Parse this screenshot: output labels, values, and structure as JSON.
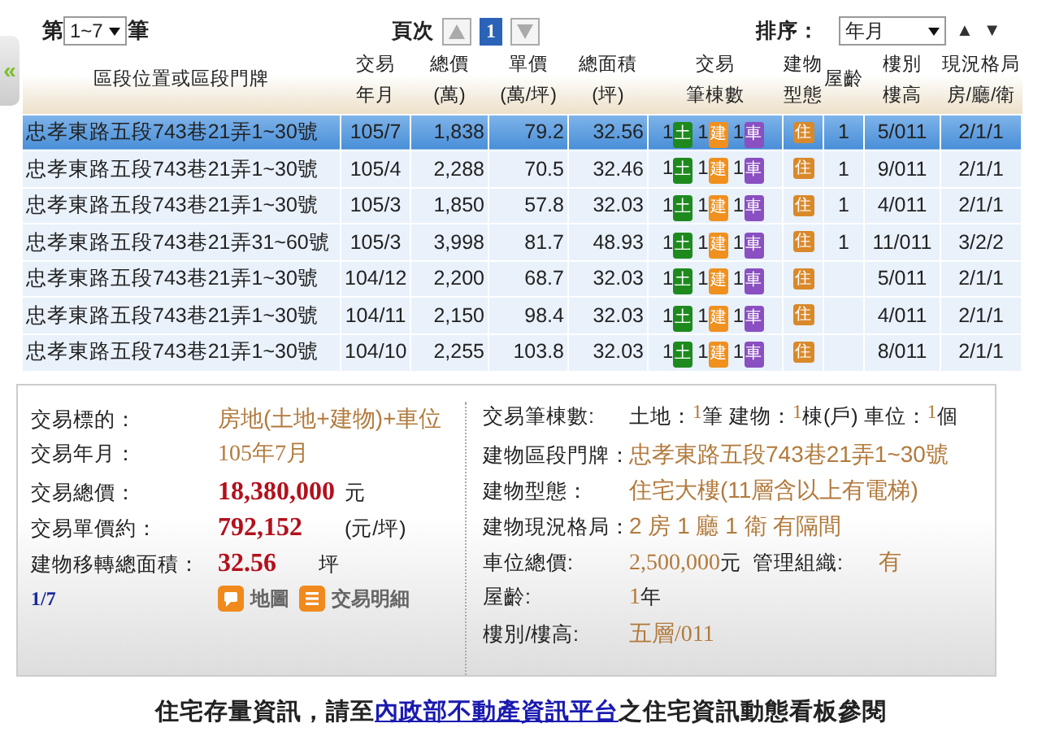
{
  "pager": {
    "prefix": "第",
    "range": "1~7",
    "suffix": "筆",
    "page_label": "頁次",
    "pages": [
      {
        "label": "1",
        "selected": true
      }
    ],
    "sort_label": "排序：",
    "sort_value": "年月",
    "sort_asc": "▲",
    "sort_desc": "▼"
  },
  "sidebar_toggle": "«",
  "table": {
    "columns": [
      [
        "區段位置或區段門牌"
      ],
      [
        "交易",
        "年月"
      ],
      [
        "總價",
        "(萬)"
      ],
      [
        "單價",
        "(萬/坪)"
      ],
      [
        "總面積",
        "(坪)"
      ],
      [
        "交易",
        "筆棟數"
      ],
      [
        "建物",
        "型態"
      ],
      [
        "屋齡"
      ],
      [
        "樓別",
        "樓高"
      ],
      [
        "現況格局",
        "房/廳/衛"
      ]
    ],
    "rows": [
      {
        "address": "忠孝東路五段743巷21弄1~30號",
        "date": "105/7",
        "total": "1,838",
        "unit": "79.2",
        "area": "32.56",
        "counts": [
          {
            "count": "1",
            "label": "土",
            "color": "#1e8a1e"
          },
          {
            "count": "1",
            "label": "建",
            "color": "#f0901e"
          },
          {
            "count": "1",
            "label": "車",
            "color": "#8a4fc0"
          }
        ],
        "type": "住",
        "age": "1",
        "floor": "5/011",
        "layout": "2/1/1",
        "selected": true
      },
      {
        "address": "忠孝東路五段743巷21弄1~30號",
        "date": "105/4",
        "total": "2,288",
        "unit": "70.5",
        "area": "32.46",
        "counts": [
          {
            "count": "1",
            "label": "土",
            "color": "#1e8a1e"
          },
          {
            "count": "1",
            "label": "建",
            "color": "#f0901e"
          },
          {
            "count": "1",
            "label": "車",
            "color": "#8a4fc0"
          }
        ],
        "type": "住",
        "age": "1",
        "floor": "9/011",
        "layout": "2/1/1",
        "selected": false
      },
      {
        "address": "忠孝東路五段743巷21弄1~30號",
        "date": "105/3",
        "total": "1,850",
        "unit": "57.8",
        "area": "32.03",
        "counts": [
          {
            "count": "1",
            "label": "土",
            "color": "#1e8a1e"
          },
          {
            "count": "1",
            "label": "建",
            "color": "#f0901e"
          },
          {
            "count": "1",
            "label": "車",
            "color": "#8a4fc0"
          }
        ],
        "type": "住",
        "age": "1",
        "floor": "4/011",
        "layout": "2/1/1",
        "selected": false
      },
      {
        "address": "忠孝東路五段743巷21弄31~60號",
        "date": "105/3",
        "total": "3,998",
        "unit": "81.7",
        "area": "48.93",
        "counts": [
          {
            "count": "1",
            "label": "土",
            "color": "#1e8a1e"
          },
          {
            "count": "1",
            "label": "建",
            "color": "#f0901e"
          },
          {
            "count": "1",
            "label": "車",
            "color": "#8a4fc0"
          }
        ],
        "type": "住",
        "age": "1",
        "floor": "11/011",
        "layout": "3/2/2",
        "selected": false
      },
      {
        "address": "忠孝東路五段743巷21弄1~30號",
        "date": "104/12",
        "total": "2,200",
        "unit": "68.7",
        "area": "32.03",
        "counts": [
          {
            "count": "1",
            "label": "土",
            "color": "#1e8a1e"
          },
          {
            "count": "1",
            "label": "建",
            "color": "#f0901e"
          },
          {
            "count": "1",
            "label": "車",
            "color": "#8a4fc0"
          }
        ],
        "type": "住",
        "floor": "5/011",
        "layout": "2/1/1",
        "selected": false
      },
      {
        "address": "忠孝東路五段743巷21弄1~30號",
        "date": "104/11",
        "total": "2,150",
        "unit": "98.4",
        "area": "32.03",
        "counts": [
          {
            "count": "1",
            "label": "土",
            "color": "#1e8a1e"
          },
          {
            "count": "1",
            "label": "建",
            "color": "#f0901e"
          },
          {
            "count": "1",
            "label": "車",
            "color": "#8a4fc0"
          }
        ],
        "type": "住",
        "floor": "4/011",
        "layout": "2/1/1",
        "selected": false
      },
      {
        "address": "忠孝東路五段743巷21弄1~30號",
        "date": "104/10",
        "total": "2,255",
        "unit": "103.8",
        "area": "32.03",
        "counts": [
          {
            "count": "1",
            "label": "土",
            "color": "#1e8a1e"
          },
          {
            "count": "1",
            "label": "建",
            "color": "#f0901e"
          },
          {
            "count": "1",
            "label": "車",
            "color": "#8a4fc0"
          }
        ],
        "type": "住",
        "floor": "8/011",
        "layout": "2/1/1",
        "selected": false
      }
    ]
  },
  "detail": {
    "left": [
      {
        "label": "交易標的：",
        "parts": [
          {
            "kind": "info",
            "text": "房地(土地+建物)+車位"
          }
        ]
      },
      {
        "label": "交易年月：",
        "parts": [
          {
            "kind": "info-serif",
            "text": "105年7月"
          }
        ]
      },
      {
        "label": "交易總價：",
        "parts": [
          {
            "kind": "price",
            "text": "18,380,000"
          },
          {
            "kind": "plain",
            "text": "元"
          }
        ]
      },
      {
        "label": "交易單價約：",
        "parts": [
          {
            "kind": "price",
            "text": "792,152"
          },
          {
            "kind": "unit",
            "text": "(元/坪)"
          }
        ]
      },
      {
        "label": "建物移轉總面積：",
        "parts": [
          {
            "kind": "price",
            "text": "32.56"
          },
          {
            "kind": "unit",
            "text": "坪"
          }
        ]
      }
    ],
    "index": "1/7",
    "actions": [
      {
        "kind": "map",
        "label": "地圖"
      },
      {
        "kind": "list",
        "label": "交易明細"
      }
    ],
    "right": [
      {
        "label": "交易筆棟數:",
        "parts": [
          {
            "kind": "plain",
            "text": "土地："
          },
          {
            "kind": "sup",
            "text": "1"
          },
          {
            "kind": "plain",
            "text": "筆 建物："
          },
          {
            "kind": "sup",
            "text": "1"
          },
          {
            "kind": "plain",
            "text": "棟(戶) 車位："
          },
          {
            "kind": "sup",
            "text": "1"
          },
          {
            "kind": "plain",
            "text": "個"
          }
        ]
      },
      {
        "label": "建物區段門牌：",
        "parts": [
          {
            "kind": "info",
            "text": "忠孝東路五段743巷21弄1~30號"
          }
        ]
      },
      {
        "label": "建物型態：",
        "parts": [
          {
            "kind": "info",
            "text": "住宅大樓(11層含以上有電梯)"
          }
        ]
      },
      {
        "label": "建物現況格局：",
        "parts": [
          {
            "kind": "info",
            "text": "2 房 1 廳 1 衛 有隔間"
          }
        ]
      },
      {
        "label": "車位總價:",
        "parts": [
          {
            "kind": "info-serif",
            "text": "2,500,000"
          },
          {
            "kind": "plain",
            "text": "元  管理組織:"
          },
          {
            "kind": "info-wide",
            "text": "有"
          }
        ]
      },
      {
        "label": "屋齡:",
        "parts": [
          {
            "kind": "info-serif",
            "text": "1"
          },
          {
            "kind": "plain",
            "text": "年"
          }
        ]
      },
      {
        "label": "樓別/樓高:",
        "parts": [
          {
            "kind": "info",
            "text": "五層"
          },
          {
            "kind": "info-serif",
            "text": "/011"
          }
        ]
      }
    ]
  },
  "notice": {
    "before": "住宅存量資訊，請至",
    "link": "內政部不動產資訊平台",
    "after": "之住宅資訊動態看板參閱"
  }
}
